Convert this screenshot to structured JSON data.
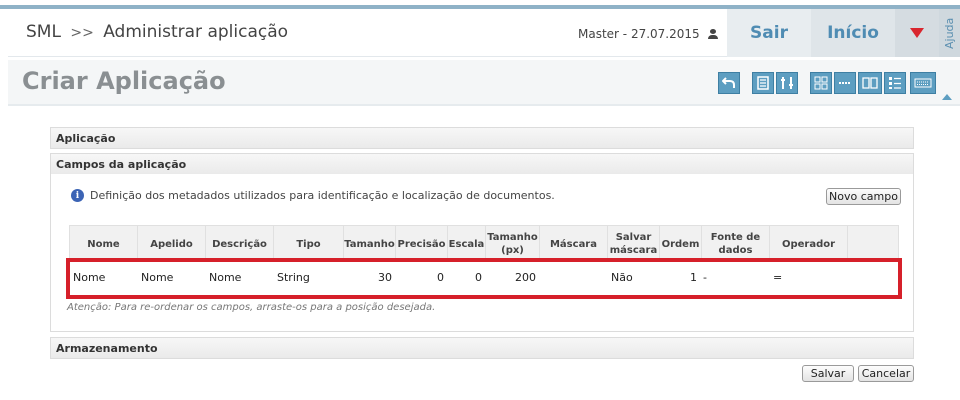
{
  "header": {
    "breadcrumb_root": "SML",
    "breadcrumb_sep": ">>",
    "breadcrumb_current": "Administrar aplicação",
    "user_info": "Master - 27.07.2015",
    "sair_label": "Sair",
    "inicio_label": "Início",
    "ajuda_label": "Ajuda"
  },
  "title": "Criar Aplicação",
  "panels": {
    "aplicacao": "Aplicação",
    "campos": "Campos da aplicação",
    "armazenamento": "Armazenamento"
  },
  "info_text": "Definição dos metadados utilizados para identificação e localização de documentos.",
  "novo_campo_label": "Novo campo",
  "table": {
    "headers": [
      "Nome",
      "Apelido",
      "Descrição",
      "Tipo",
      "Tamanho",
      "Precisão",
      "Escala",
      "Tamanho (px)",
      "Máscara",
      "Salvar máscara",
      "Ordem",
      "Fonte de dados",
      "Operador"
    ],
    "row": [
      "Nome",
      "Nome",
      "Nome",
      "String",
      "30",
      "0",
      "0",
      "200",
      "",
      "Não",
      "1",
      "-",
      "="
    ]
  },
  "note": "Atenção: Para re-ordenar os campos, arraste-os para a posição desejada.",
  "buttons": {
    "salvar": "Salvar",
    "cancelar": "Cancelar"
  },
  "colors": {
    "accent": "#4f8cb3",
    "highlight": "#d6202a"
  }
}
